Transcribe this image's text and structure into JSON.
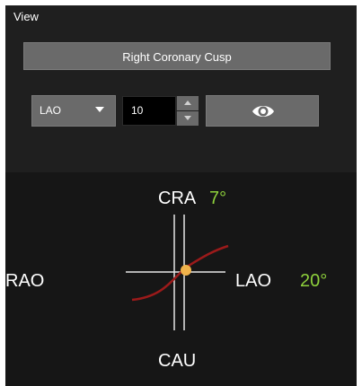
{
  "panel": {
    "title": "View"
  },
  "cusp_button": {
    "label": "Right Coronary Cusp"
  },
  "projection": {
    "selected": "LAO",
    "angle_value": "10"
  },
  "orientation": {
    "cra_label": "CRA",
    "cra_angle": "7°",
    "cau_label": "CAU",
    "rao_label": "RAO",
    "lao_label": "LAO",
    "lao_angle": "20°"
  },
  "colors": {
    "panel_bg": "#1c1c1c",
    "button_bg": "#6a6a6a",
    "angle_green": "#8ed13c",
    "curve_red": "#9b1a1a",
    "marker_orange": "#f0b24a"
  },
  "icons": {
    "dropdown": "chevron-down-icon",
    "spin_up": "arrow-up-icon",
    "spin_down": "arrow-down-icon",
    "eye": "eye-icon"
  }
}
